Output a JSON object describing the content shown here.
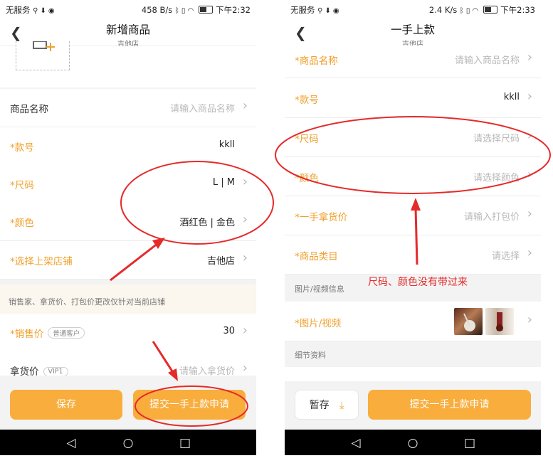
{
  "left": {
    "status": {
      "carrier": "无服务",
      "speed": "458 B/s",
      "time": "下午2:32"
    },
    "title": "新增商品",
    "subtitle": "吉他店",
    "rows": [
      {
        "label": "商品名称",
        "value": "请输入商品名称",
        "required": false,
        "placeholder": true
      },
      {
        "label": "*款号",
        "value": "kkll",
        "required": true,
        "placeholder": false
      },
      {
        "label": "*尺码",
        "value": "L | M",
        "required": true,
        "placeholder": false
      },
      {
        "label": "*颜色",
        "value": "酒红色 | 金色",
        "required": true,
        "placeholder": false
      },
      {
        "label": "*选择上架店铺",
        "value": "吉他店",
        "required": true,
        "placeholder": false
      }
    ],
    "note": "销售家、拿货价、打包价更改仅针对当前店铺",
    "price_rows": [
      {
        "label": "*销售价",
        "badge": "普通客户",
        "value": "30",
        "required": true,
        "placeholder": false
      },
      {
        "label": "拿货价",
        "badge": "VIP1",
        "value": "请输入拿货价",
        "required": false,
        "placeholder": true
      }
    ],
    "save_label": "保存",
    "submit_label": "提交一手上款申请"
  },
  "right": {
    "status": {
      "carrier": "无服务",
      "speed": "2.4 K/s",
      "time": "下午2:33"
    },
    "title": "一手上款",
    "subtitle": "吉他店",
    "rows": [
      {
        "label": "*商品名称",
        "value": "请输入商品名称",
        "required": true,
        "placeholder": true
      },
      {
        "label": "*款号",
        "value": "kkll",
        "required": true,
        "placeholder": false
      },
      {
        "label": "*尺码",
        "value": "请选择尺码",
        "required": true,
        "placeholder": true
      },
      {
        "label": "*颜色",
        "value": "请选择颜色",
        "required": true,
        "placeholder": true
      },
      {
        "label": "*一手拿货价",
        "value": "请输入打包价",
        "required": true,
        "placeholder": true
      },
      {
        "label": "*商品类目",
        "value": "请选择",
        "required": true,
        "placeholder": true
      }
    ],
    "media_section": "图片/视频信息",
    "media_label": "*图片/视频",
    "detail_section": "细节资料",
    "draft_label": "暂存",
    "submit_label": "提交一手上款申请"
  },
  "annotation": "尺码、颜色没有带过来",
  "colors": {
    "accent": "#f8ad3c",
    "required": "#f0a02c",
    "annotation": "#e52a2a"
  }
}
